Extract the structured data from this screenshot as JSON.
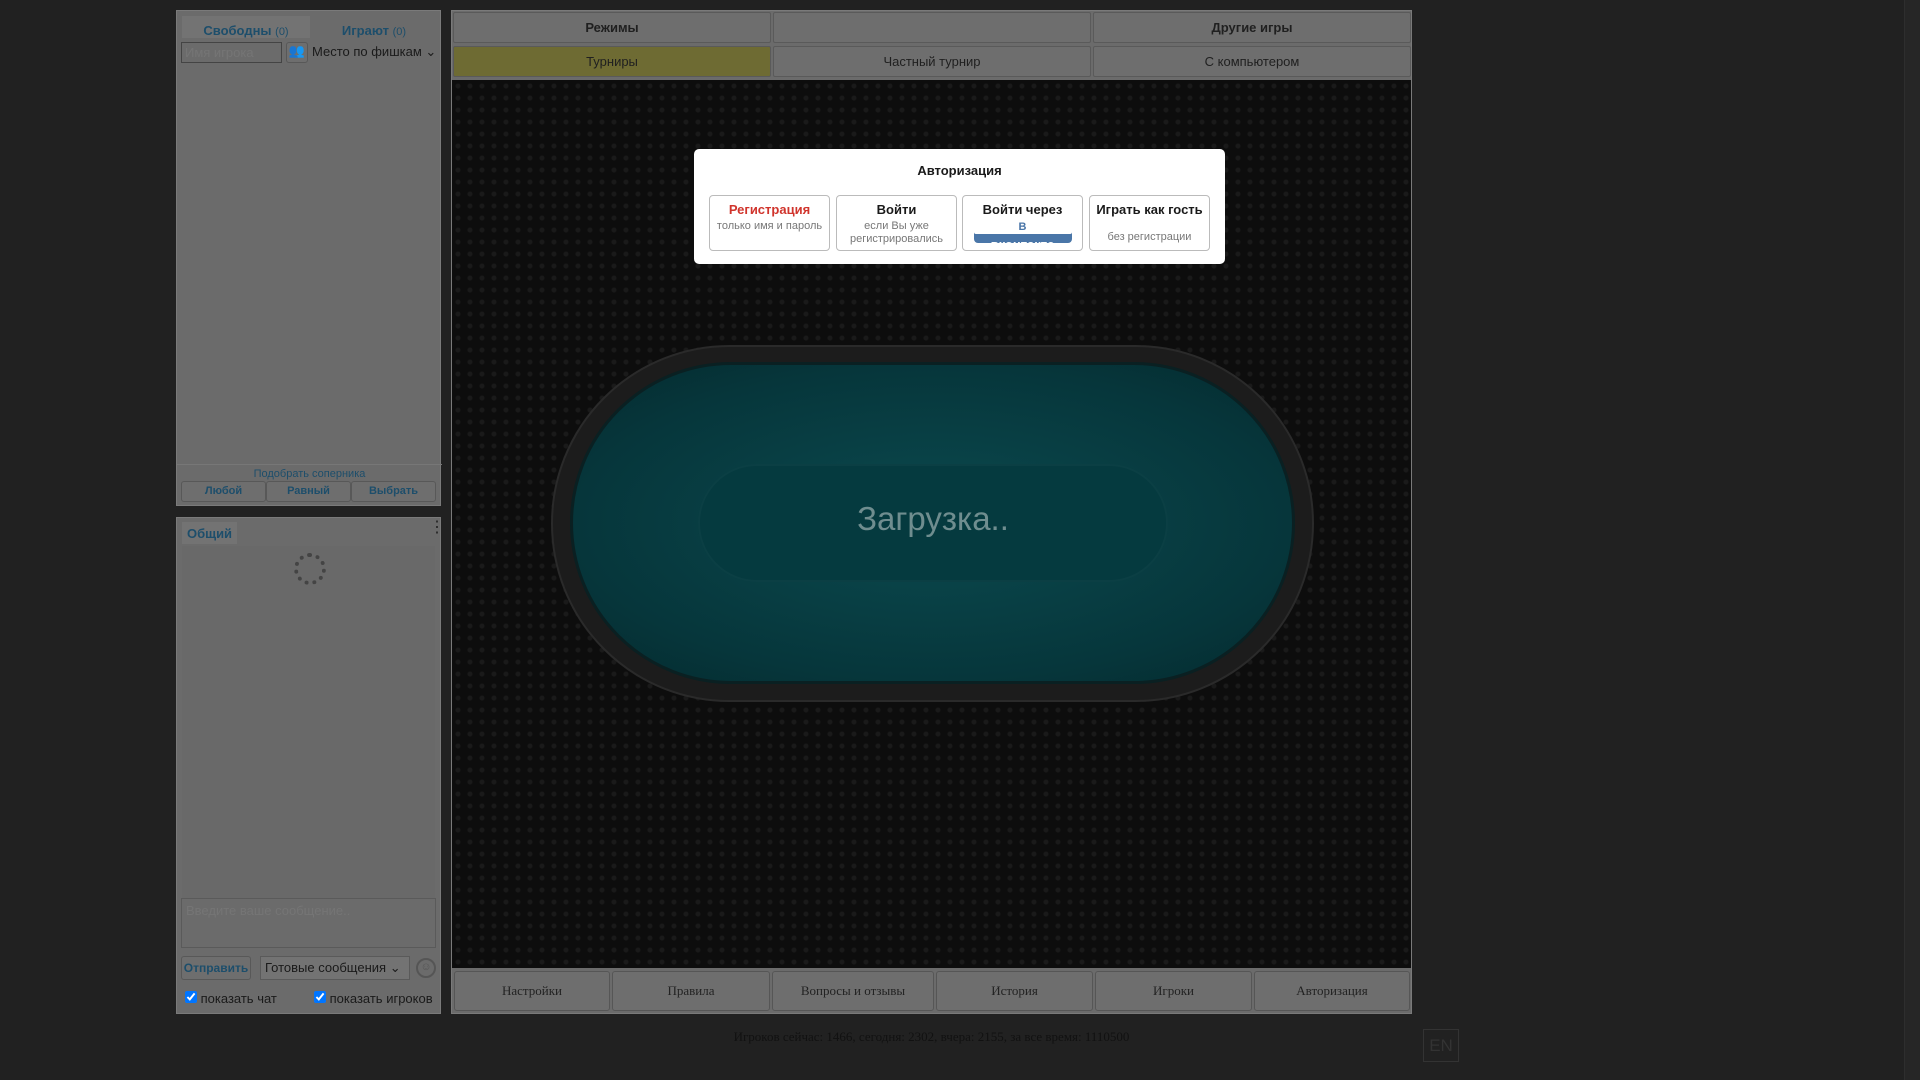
{
  "players_panel": {
    "tab_free": "Свободны",
    "tab_free_count": "(0)",
    "tab_playing": "Играют",
    "tab_playing_count": "(0)",
    "search_placeholder": "Имя игрока",
    "sort_select": "Место по фишкам",
    "match_title": "Подобрать соперника",
    "match_buttons": [
      "Любой",
      "Равный",
      "Выбрать"
    ]
  },
  "chat_panel": {
    "tab": "Общий",
    "message_placeholder": "Введите ваше сообщение..",
    "send": "Отправить",
    "ready_select": "Готовые сообщения",
    "show_chat": "показать чат",
    "show_players": "показать игроков"
  },
  "top_tabs": {
    "row1": [
      "Режимы",
      "",
      "Другие игры"
    ],
    "row2": [
      "Турниры",
      "Частный турнир",
      "С компьютером"
    ]
  },
  "table": {
    "loading": "Загрузка.."
  },
  "auth_modal": {
    "title": "Авторизация",
    "options": [
      {
        "title": "Регистрация",
        "sub": "только имя и пароль"
      },
      {
        "title": "Войти",
        "sub": "если Вы уже регистрировались"
      },
      {
        "title": "Войти через",
        "sub": "вконтакте"
      },
      {
        "title": "Играть как гость",
        "sub": "без регистрации"
      }
    ]
  },
  "bottom_nav": [
    "Настройки",
    "Правила",
    "Вопросы и отзывы",
    "История",
    "Игроки",
    "Авторизация"
  ],
  "footer": "Игроков сейчас: 1466, сегодня: 2302, вчера: 2155, за все время: 1110500",
  "lang": "EN",
  "colors": {
    "accent": "#1d4e6b",
    "register": "#d0342c",
    "vk": "#4a76a8"
  }
}
